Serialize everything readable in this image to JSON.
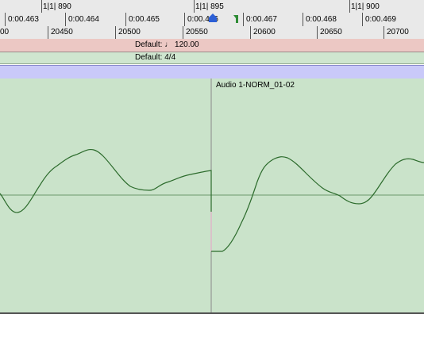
{
  "rulers": {
    "bars": [
      {
        "label": "1|1| 890"
      },
      {
        "label": "1|1| 895"
      },
      {
        "label": "1|1| 900"
      }
    ],
    "time": [
      {
        "label": "0:00.463"
      },
      {
        "label": "0:00.464"
      },
      {
        "label": "0:00.465"
      },
      {
        "label": "0:00.466"
      },
      {
        "label": "0:00.467"
      },
      {
        "label": "0:00.468"
      },
      {
        "label": "0:00.469"
      }
    ],
    "samples": [
      {
        "label": "00"
      },
      {
        "label": "20450"
      },
      {
        "label": "20500"
      },
      {
        "label": "20550"
      },
      {
        "label": "20600"
      },
      {
        "label": "20650"
      },
      {
        "label": "20700"
      }
    ]
  },
  "tempo_track": {
    "prefix": "Default:",
    "value": "120.00",
    "note_icon": "quarter-note-icon"
  },
  "meter_track": {
    "label": "Default: 4/4"
  },
  "clip": {
    "name": "Audio 1-NORM_01-02"
  },
  "colors": {
    "waveform_bg": "#cae3ca",
    "waveform_line": "#2c6b2c",
    "tempo_bg": "#ecc8c4",
    "meter_bg": "#cfe6cf",
    "marker_bg": "#c9c9f9",
    "playhead": "#8a8a8a",
    "insertion_marker": "#2c5fd6"
  }
}
